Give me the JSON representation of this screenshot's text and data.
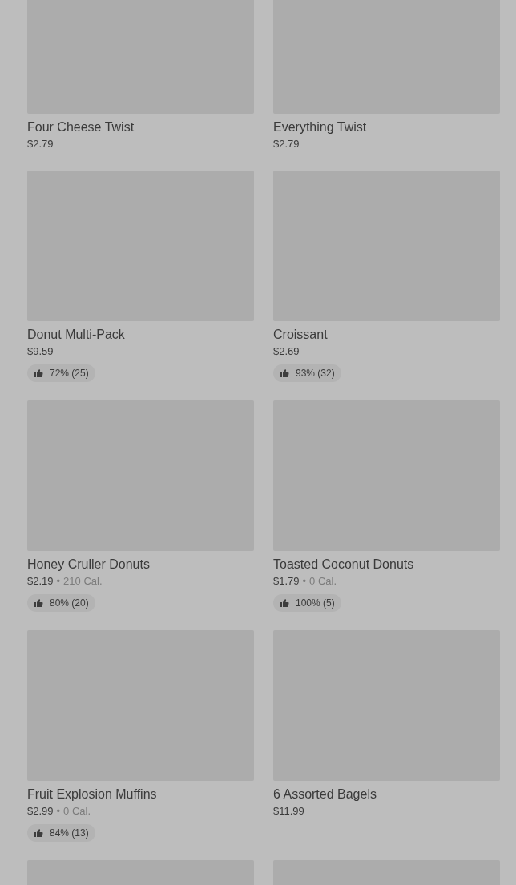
{
  "items": [
    {
      "kind": "product",
      "name": "Four Cheese Twist",
      "price": "$2.79"
    },
    {
      "kind": "product",
      "name": "Everything Twist",
      "price": "$2.79"
    },
    {
      "kind": "product",
      "name": "Donut Multi-Pack",
      "price": "$9.59",
      "rating": "72% (25)"
    },
    {
      "kind": "product",
      "name": "Croissant",
      "price": "$2.69",
      "rating": "93% (32)"
    },
    {
      "kind": "product",
      "name": "Honey Cruller Donuts",
      "price": "$2.19",
      "separator": "•",
      "calories": "210 Cal.",
      "rating": "80% (20)"
    },
    {
      "kind": "product",
      "name": "Toasted Coconut Donuts",
      "price": "$1.79",
      "separator": "•",
      "calories": "0 Cal.",
      "rating": "100% (5)"
    },
    {
      "kind": "product",
      "name": "Fruit Explosion Muffins",
      "price": "$2.99",
      "separator": "•",
      "calories": "0 Cal.",
      "rating": "84% (13)"
    },
    {
      "kind": "product",
      "name": "6 Assorted Bagels",
      "price": "$11.99"
    },
    {
      "kind": "image-only"
    },
    {
      "kind": "image-only"
    }
  ]
}
